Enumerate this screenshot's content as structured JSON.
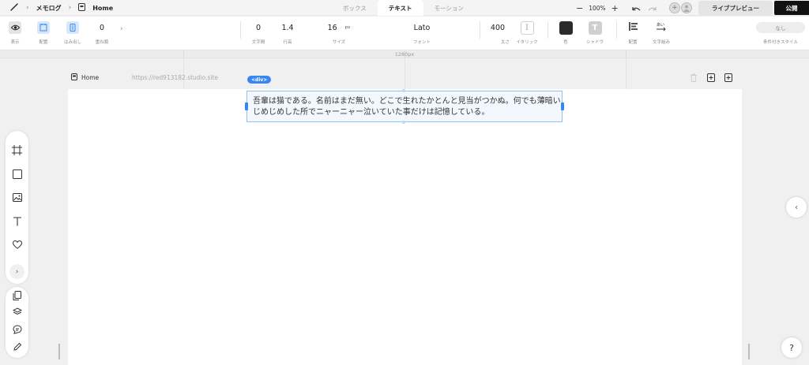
{
  "topbar": {
    "breadcrumb": [
      "メモログ",
      "Home"
    ],
    "tabs": [
      {
        "label": "ボックス",
        "active": false
      },
      {
        "label": "テキスト",
        "active": true
      },
      {
        "label": "モーション",
        "active": false
      }
    ],
    "zoom": "100%",
    "live_preview_label": "ライブプレビュー",
    "publish_label": "公開"
  },
  "toolbar": {
    "display_label": "表示",
    "layout_label": "配置",
    "overflow_label": "はみ出し",
    "zorder_value": "0",
    "zorder_label": "重ね順",
    "letter_spacing_value": "0",
    "letter_spacing_label": "文字間",
    "line_height_value": "1.4",
    "line_height_label": "行高",
    "size_value": "16",
    "size_unit": "px",
    "size_label": "サイズ",
    "font_value": "Lato",
    "font_label": "フォント",
    "weight_value": "400",
    "weight_label": "太さ",
    "italic_label": "イタリック",
    "color_label": "色",
    "text_color": "#2b2b2b",
    "shadow_label": "シャドウ",
    "align_label": "配置",
    "wrap_label": "文字組み",
    "conditional_value": "なし",
    "conditional_label": "条件付きスタイル"
  },
  "canvas": {
    "ruler_label": "1280px",
    "page_name": "Home",
    "page_url": "https://red913182.studio.site",
    "selected_tag": "<div>",
    "text_content": "吾輩は猫である。名前はまだ無い。どこで生れたかとんと見当がつかぬ。何でも薄暗いじめじめした所でニャーニャー泣いていた事だけは記憶している。"
  },
  "accent_color": "#3a86f0",
  "help_label": "?"
}
